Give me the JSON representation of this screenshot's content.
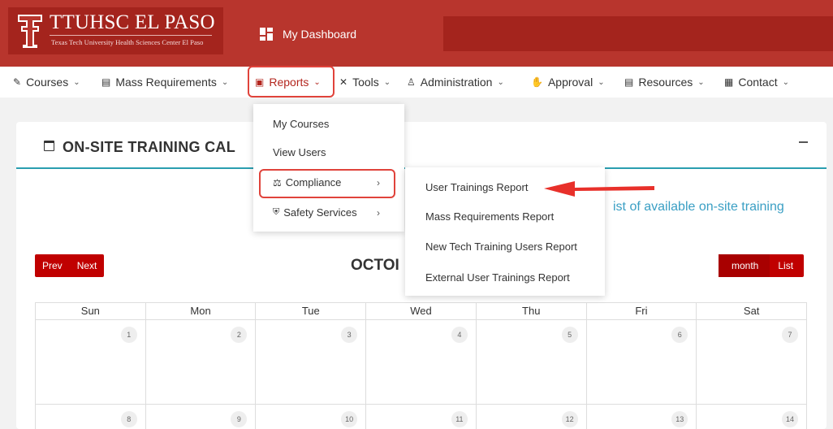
{
  "header": {
    "logo_title": "TTUHSC EL PASO",
    "logo_subtitle": "Texas Tech University Health Sciences Center El Paso",
    "dashboard_label": "My Dashboard",
    "brand_color": "#b8352d",
    "brand_dark": "#a4241d"
  },
  "nav": {
    "items": [
      {
        "label": "Courses",
        "icon": "book-icon"
      },
      {
        "label": "Mass Requirements",
        "icon": "clipboard-icon"
      },
      {
        "label": "Reports",
        "icon": "presentation-icon"
      },
      {
        "label": "Tools",
        "icon": "tools-icon"
      },
      {
        "label": "Administration",
        "icon": "users-icon"
      },
      {
        "label": "Approval",
        "icon": "approval-icon"
      },
      {
        "label": "Resources",
        "icon": "resources-icon"
      },
      {
        "label": "Contact",
        "icon": "contact-icon"
      }
    ],
    "active_color": "#b3261e"
  },
  "reports_menu": {
    "items": [
      {
        "label": "My Courses"
      },
      {
        "label": "View Users"
      },
      {
        "label": "Compliance",
        "icon": "scale-icon"
      },
      {
        "label": "Safety Services",
        "icon": "shield-icon"
      }
    ]
  },
  "compliance_menu": {
    "items": [
      {
        "label": "User Trainings Report"
      },
      {
        "label": "Mass Requirements Report"
      },
      {
        "label": "New Tech Training Users Report"
      },
      {
        "label": "External User Trainings Report"
      }
    ]
  },
  "card": {
    "title": "ON-SITE TRAINING CAL",
    "body_text": "ist of available on-site training",
    "accent_color": "#2a9eb0"
  },
  "calendar": {
    "prev_label": "Prev",
    "next_label": "Next",
    "month_label": "month",
    "list_label": "List",
    "title": "OCTOI",
    "weekdays": [
      "Sun",
      "Mon",
      "Tue",
      "Wed",
      "Thu",
      "Fri",
      "Sat"
    ],
    "week1": [
      "1",
      "2",
      "3",
      "4",
      "5",
      "6",
      "7"
    ],
    "week2": [
      "8",
      "9",
      "10",
      "11",
      "12",
      "13",
      "14"
    ]
  }
}
